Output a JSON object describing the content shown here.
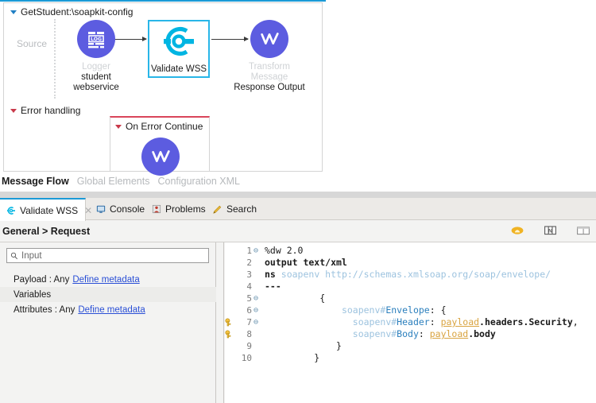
{
  "flow": {
    "title": "GetStudent:\\soapkit-config",
    "source_label": "Source",
    "nodes": [
      {
        "name": "logger",
        "icon": "log-icon",
        "label": "Logger",
        "sub1": "student",
        "sub2": "webservice",
        "dim": true
      },
      {
        "name": "validate-wss",
        "icon": "validate-wss-icon",
        "label": "Validate WSS",
        "sub1": "",
        "sub2": "",
        "dim": false
      },
      {
        "name": "transform-message",
        "icon": "transform-message-icon",
        "label": "Transform Message",
        "sub1": "Response Output",
        "sub2": "",
        "dim": true
      }
    ],
    "error_handling": {
      "title": "Error handling",
      "scope_title": "On Error Continue",
      "scope_icon": "transform-message-icon"
    },
    "tabs": [
      {
        "label": "Message Flow",
        "active": true
      },
      {
        "label": "Global Elements",
        "active": false
      },
      {
        "label": "Configuration XML",
        "active": false
      }
    ]
  },
  "panel": {
    "tabs": [
      {
        "label": "Validate WSS",
        "icon": "validate-wss-icon",
        "active": true,
        "closable": true
      },
      {
        "label": "Console",
        "icon": "console-icon",
        "active": false,
        "closable": false
      },
      {
        "label": "Problems",
        "icon": "problems-icon",
        "active": false,
        "closable": false
      },
      {
        "label": "Search",
        "icon": "search-icon",
        "active": false,
        "closable": false
      }
    ],
    "breadcrumb": "General > Request",
    "toolbar_icons": [
      {
        "name": "preview-icon",
        "color": "#f0b323"
      },
      {
        "name": "show-metadata-icon",
        "color": "#6e6e6e"
      },
      {
        "name": "split-view-icon",
        "color": "#6e6e6e"
      }
    ]
  },
  "input": {
    "search_placeholder": "Input",
    "search_value": "",
    "rows": [
      {
        "label": "Payload : Any",
        "link": "Define metadata"
      },
      {
        "label": "Variables",
        "link": ""
      },
      {
        "label": "Attributes : Any",
        "link": "Define metadata"
      }
    ]
  },
  "editor": {
    "lines": [
      {
        "n": "1",
        "fold": true,
        "warn": false,
        "segs": [
          {
            "t": "%dw 2.0",
            "c": "plain"
          }
        ]
      },
      {
        "n": "2",
        "fold": false,
        "warn": false,
        "segs": [
          {
            "t": "output text/xml",
            "c": "kw"
          }
        ]
      },
      {
        "n": "3",
        "fold": false,
        "warn": false,
        "segs": [
          {
            "t": "ns",
            "c": "kw"
          },
          {
            "t": " soapenv http://schemas.xmlsoap.org/soap/envelope/",
            "c": "ns"
          }
        ]
      },
      {
        "n": "4",
        "fold": false,
        "warn": false,
        "segs": [
          {
            "t": "---",
            "c": "kw"
          }
        ]
      },
      {
        "n": "5",
        "fold": true,
        "warn": false,
        "segs": [
          {
            "t": "          {",
            "c": "plain"
          }
        ]
      },
      {
        "n": "6",
        "fold": true,
        "warn": false,
        "segs": [
          {
            "t": "              ",
            "c": "plain"
          },
          {
            "t": "soapenv#",
            "c": "ns"
          },
          {
            "t": "Envelope",
            "c": "tag"
          },
          {
            "t": ": {",
            "c": "plain"
          }
        ]
      },
      {
        "n": "7",
        "fold": true,
        "warn": true,
        "segs": [
          {
            "t": "                ",
            "c": "plain"
          },
          {
            "t": "soapenv#",
            "c": "ns"
          },
          {
            "t": "Header",
            "c": "tag"
          },
          {
            "t": ": ",
            "c": "plain"
          },
          {
            "t": "payload",
            "c": "var"
          },
          {
            "t": ".headers.Security",
            "c": "prop"
          },
          {
            "t": ",",
            "c": "plain"
          }
        ]
      },
      {
        "n": "8",
        "fold": false,
        "warn": true,
        "segs": [
          {
            "t": "                ",
            "c": "plain"
          },
          {
            "t": "soapenv#",
            "c": "ns"
          },
          {
            "t": "Body",
            "c": "tag"
          },
          {
            "t": ": ",
            "c": "plain"
          },
          {
            "t": "payload",
            "c": "var"
          },
          {
            "t": ".body",
            "c": "prop"
          }
        ]
      },
      {
        "n": "9",
        "fold": false,
        "warn": false,
        "segs": [
          {
            "t": "             }",
            "c": "plain"
          }
        ]
      },
      {
        "n": "10",
        "fold": false,
        "warn": false,
        "segs": [
          {
            "t": "         }",
            "c": "plain"
          }
        ]
      }
    ]
  },
  "colors": {
    "accent_blue": "#1b9ad6",
    "node_purple": "#5c5ce0",
    "node_cyan": "#00b5e2",
    "error_red": "#d9455a",
    "link_blue": "#2a4fd6"
  }
}
